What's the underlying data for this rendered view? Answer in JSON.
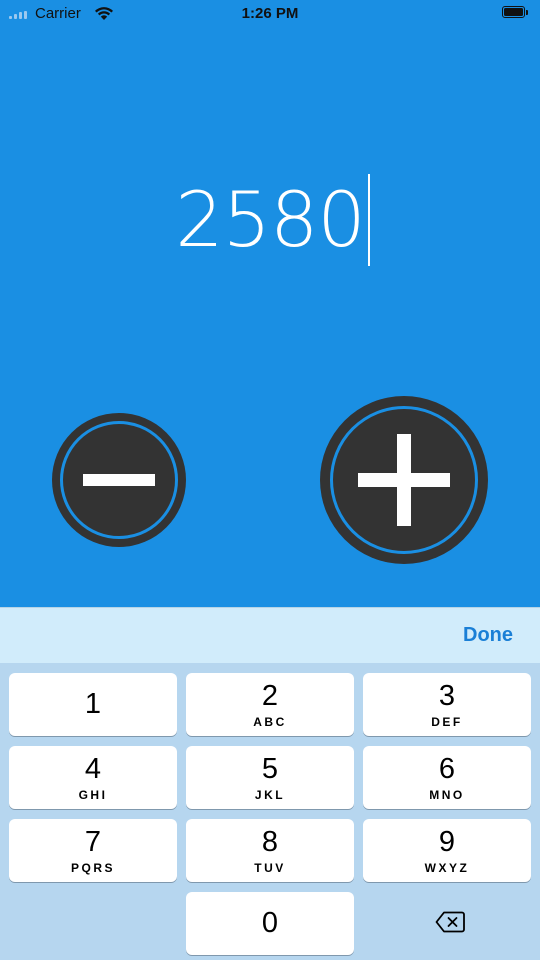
{
  "status_bar": {
    "carrier": "Carrier",
    "time": "1:26 PM"
  },
  "counter": {
    "value": "2580"
  },
  "buttons": {
    "decrement_icon": "minus-icon",
    "increment_icon": "plus-icon"
  },
  "keyboard": {
    "done_label": "Done",
    "keys": [
      {
        "digit": "1",
        "letters": ""
      },
      {
        "digit": "2",
        "letters": "ABC"
      },
      {
        "digit": "3",
        "letters": "DEF"
      },
      {
        "digit": "4",
        "letters": "GHI"
      },
      {
        "digit": "5",
        "letters": "JKL"
      },
      {
        "digit": "6",
        "letters": "MNO"
      },
      {
        "digit": "7",
        "letters": "PQRS"
      },
      {
        "digit": "8",
        "letters": "TUV"
      },
      {
        "digit": "9",
        "letters": "WXYZ"
      },
      {
        "digit": "0",
        "letters": ""
      }
    ],
    "delete_icon": "backspace-icon"
  },
  "colors": {
    "background": "#1a8fe3",
    "button_fill": "#333333",
    "accent_text": "#1a7fd6",
    "keyboard_bg": "#b6d6ef",
    "accessory_bg": "#d1ecfb"
  }
}
